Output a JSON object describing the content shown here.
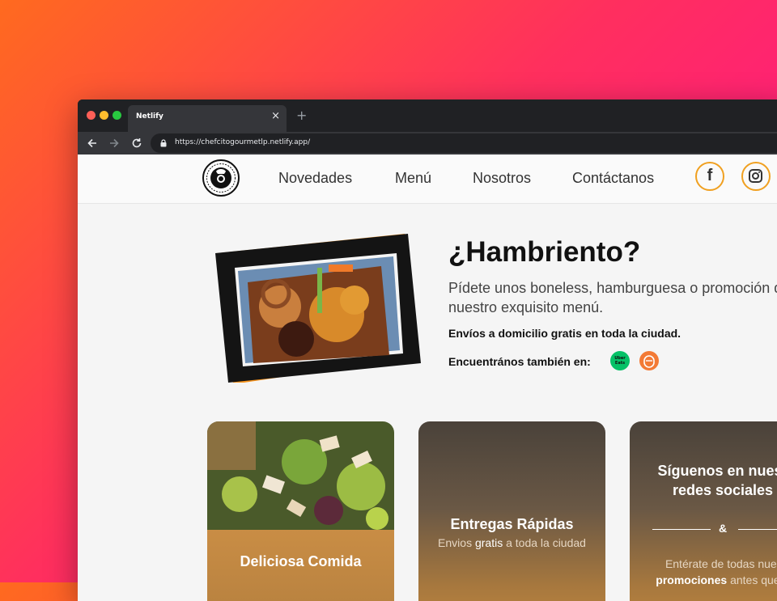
{
  "browser": {
    "tab_title": "Netlify",
    "tab_close": "×",
    "new_tab": "+",
    "url": "https://chefcitogourmetlp.netlify.app/"
  },
  "nav": {
    "links": [
      "Novedades",
      "Menú",
      "Nosotros",
      "Contáctanos"
    ],
    "social": [
      "facebook",
      "instagram"
    ],
    "facebook_glyph": "f"
  },
  "hero": {
    "title": "¿Hambriento?",
    "subtitle_line1": "Pídete unos boneless, hamburguesa o promoción de",
    "subtitle_line2": "nuestro exquisito menú.",
    "delivery": "Envíos a domicilio gratis en toda la ciudad.",
    "find_us": "Encuentrános también en:",
    "uber_badge": "Uber Eats"
  },
  "cards": [
    {
      "title": "Deliciosa Comida"
    },
    {
      "title": "Entregas Rápidas",
      "sub_pre": "Envios ",
      "sub_bold": "gratis",
      "sub_post": " a toda la ciudad"
    },
    {
      "title_line1": "Síguenos en nuestras",
      "title_line2": "redes sociales",
      "divider_symbol": "&",
      "text_line1": "Entérate de todas nuestras",
      "text_bold": "promociones",
      "text_post": " antes que nadie"
    }
  ],
  "colors": {
    "accent": "#f0a020",
    "card_gold": "#b7813f",
    "orange_frame": "#f7941d"
  }
}
